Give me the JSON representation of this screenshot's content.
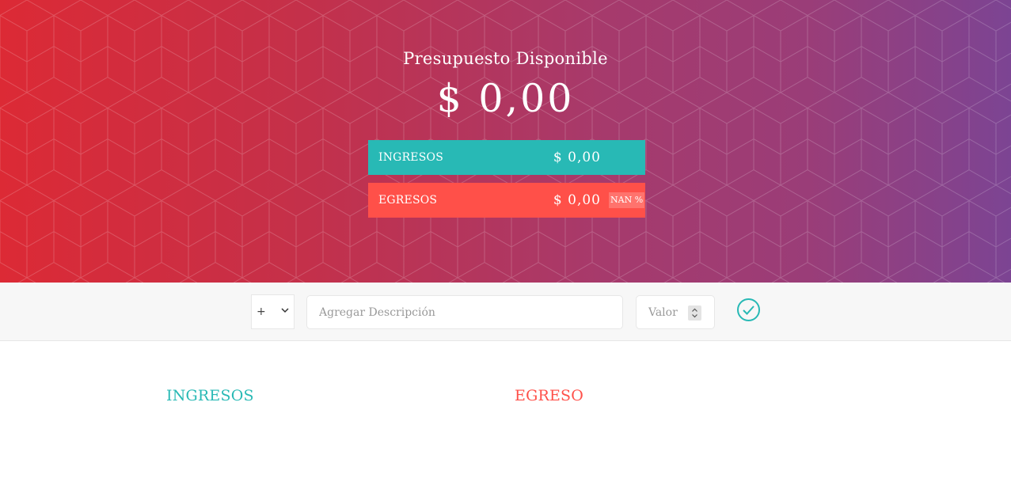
{
  "header": {
    "title": "Presupuesto Disponible",
    "budget": "$ 0,00"
  },
  "summary": {
    "income": {
      "label": "INGRESOS",
      "value": "$ 0,00",
      "color": "#28b9b5"
    },
    "expense": {
      "label": "EGRESOS",
      "value": "$ 0,00",
      "percentage": "NAN %",
      "color": "#ff5049"
    }
  },
  "add_form": {
    "type_selected": "+",
    "description_placeholder": "Agregar Descripción",
    "value_placeholder": "Valor",
    "submit_icon": "checkmark-circle-icon"
  },
  "lists": {
    "income_title": "INGRESOS",
    "expense_title": "EGRESO"
  }
}
